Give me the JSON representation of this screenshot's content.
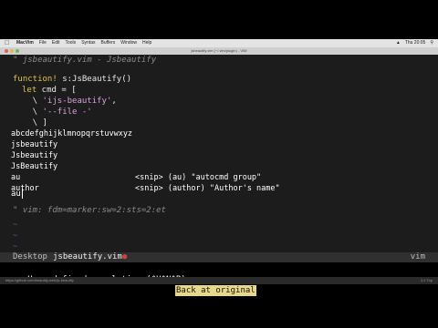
{
  "menubar": {
    "app_name": "MacVim",
    "items": [
      "File",
      "Edit",
      "Tools",
      "Syntax",
      "Buffers",
      "Window",
      "Help"
    ],
    "right_items": [
      "Thu 20:05"
    ]
  },
  "window": {
    "title": "jsbeautify.vim (~/.vim/plugin) - VIM"
  },
  "editor": {
    "lines": {
      "l1": "\" jsbeautify.vim - Jsbeautify",
      "l2_kw": "function!",
      "l2_rest": " s:JsBeautify()",
      "l3_kw": "let",
      "l3_rest": " cmd = [",
      "l4_pre": "    \\ ",
      "l4_str": "'ijs-beautify'",
      "l4_post": ",",
      "l5_pre": "    \\ ",
      "l5_str": "'--file -'",
      "l6": "    \\ ]",
      "modeline": "\" vim: fdm=marker:sw=2:sts=2:et"
    },
    "tilde": "~"
  },
  "completion": {
    "items": [
      {
        "word": "abcdefghijklmnopqrstuvwxyz",
        "menu": ""
      },
      {
        "word": "jsbeautify",
        "menu": ""
      },
      {
        "word": "Jsbeautify",
        "menu": ""
      },
      {
        "word": "JsBeautify",
        "menu": ""
      },
      {
        "word": "au",
        "menu": "<snip> (au) \"autocmd group\""
      },
      {
        "word": "author",
        "menu": "<snip> (author) \"Author's name\""
      }
    ],
    "typed": "au"
  },
  "statusline": {
    "cwd": "Desktop",
    "filename": "jsbeautify.vim",
    "modified_flag": "●",
    "filetype": "vim"
  },
  "cmdline": {
    "message": "-- User defined completion (^U^N^P)",
    "highlight": "Back at original"
  },
  "urlbar": {
    "url": "https://github.com/beautify-web/js-beautify",
    "position": "2,2 Top"
  },
  "colors": {
    "background": "#1c1c1c",
    "keyword": "#e0c44a",
    "string": "#d9a0d9",
    "comment": "#8a8a8a",
    "tilde": "#4a5a8a",
    "highlight_bg": "#e8d98a"
  }
}
